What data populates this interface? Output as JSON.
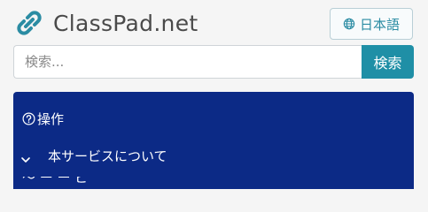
{
  "header": {
    "brand": "ClassPad.net",
    "language_button": "日本語"
  },
  "search": {
    "placeholder": "検索...",
    "button_label": "検索"
  },
  "nav": {
    "heading": "操作",
    "items": [
      {
        "label": "本サービスについて"
      }
    ]
  },
  "colors": {
    "brand_teal": "#2b8ca3",
    "search_button": "#1f8fa6",
    "nav_panel": "#0c2a86"
  }
}
